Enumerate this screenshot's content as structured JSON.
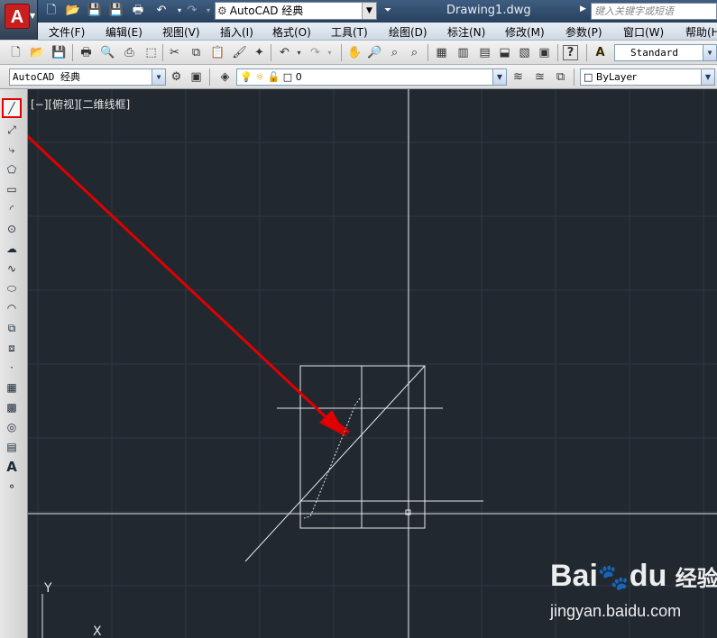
{
  "title_bar": {
    "logo_letter": "A",
    "workspace": "AutoCAD 经典",
    "document_title": "Drawing1.dwg",
    "search_placeholder": "键入关键字或短语"
  },
  "menu": [
    {
      "label": "文件(F)"
    },
    {
      "label": "编辑(E)"
    },
    {
      "label": "视图(V)"
    },
    {
      "label": "插入(I)"
    },
    {
      "label": "格式(O)"
    },
    {
      "label": "工具(T)"
    },
    {
      "label": "绘图(D)"
    },
    {
      "label": "标注(N)"
    },
    {
      "label": "修改(M)"
    },
    {
      "label": "参数(P)"
    },
    {
      "label": "窗口(W)"
    },
    {
      "label": "帮助(H)"
    }
  ],
  "toolbar": {
    "text_style": "Standard",
    "workspace_combo": "AutoCAD 经典",
    "layer": "0",
    "color": "ByLayer"
  },
  "drawing": {
    "viewport_label": "[−][俯视][二维线框]",
    "ucs_y_label": "Y",
    "ucs_x_label": "X"
  },
  "draw_tools": [
    {
      "name": "line-icon",
      "glyph": "╱"
    },
    {
      "name": "construction-line-icon",
      "glyph": "⤢"
    },
    {
      "name": "polyline-icon",
      "glyph": "⤷"
    },
    {
      "name": "polygon-icon",
      "glyph": "⬠"
    },
    {
      "name": "rectangle-icon",
      "glyph": "▭"
    },
    {
      "name": "arc-icon",
      "glyph": "◜"
    },
    {
      "name": "circle-icon",
      "glyph": "⊙"
    },
    {
      "name": "revision-cloud-icon",
      "glyph": "☁"
    },
    {
      "name": "spline-icon",
      "glyph": "∿"
    },
    {
      "name": "ellipse-icon",
      "glyph": "⬭"
    },
    {
      "name": "ellipse-arc-icon",
      "glyph": "◠"
    },
    {
      "name": "insert-block-icon",
      "glyph": "⧉"
    },
    {
      "name": "make-block-icon",
      "glyph": "⧈"
    },
    {
      "name": "point-icon",
      "glyph": "·"
    },
    {
      "name": "hatch-icon",
      "glyph": "▦"
    },
    {
      "name": "gradient-icon",
      "glyph": "▩"
    },
    {
      "name": "region-icon",
      "glyph": "◎"
    },
    {
      "name": "table-icon",
      "glyph": "▤"
    },
    {
      "name": "multiline-text-icon",
      "glyph": "A"
    },
    {
      "name": "add-selected-icon",
      "glyph": "⚬"
    }
  ],
  "watermark": {
    "brand": "Bai",
    "brand_suffix": "du",
    "brand_cn": "经验",
    "url": "jingyan.baidu.com"
  },
  "colors": {
    "canvas_bg": "#212830",
    "grid": "#2e3742",
    "geometry": "#e8e8e8",
    "highlight_arrow": "#e00000"
  }
}
